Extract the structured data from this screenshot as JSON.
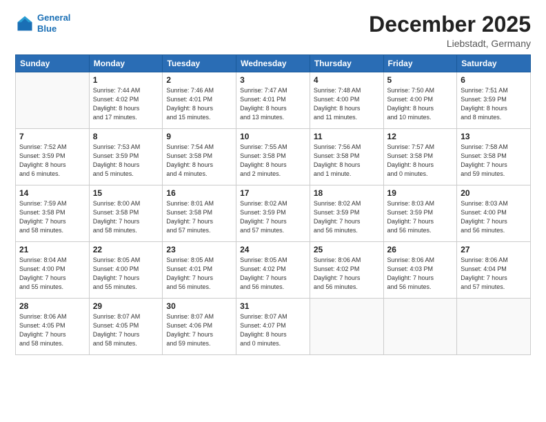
{
  "header": {
    "logo_line1": "General",
    "logo_line2": "Blue",
    "month": "December 2025",
    "location": "Liebstadt, Germany"
  },
  "weekdays": [
    "Sunday",
    "Monday",
    "Tuesday",
    "Wednesday",
    "Thursday",
    "Friday",
    "Saturday"
  ],
  "weeks": [
    [
      {
        "day": "",
        "info": ""
      },
      {
        "day": "1",
        "info": "Sunrise: 7:44 AM\nSunset: 4:02 PM\nDaylight: 8 hours\nand 17 minutes."
      },
      {
        "day": "2",
        "info": "Sunrise: 7:46 AM\nSunset: 4:01 PM\nDaylight: 8 hours\nand 15 minutes."
      },
      {
        "day": "3",
        "info": "Sunrise: 7:47 AM\nSunset: 4:01 PM\nDaylight: 8 hours\nand 13 minutes."
      },
      {
        "day": "4",
        "info": "Sunrise: 7:48 AM\nSunset: 4:00 PM\nDaylight: 8 hours\nand 11 minutes."
      },
      {
        "day": "5",
        "info": "Sunrise: 7:50 AM\nSunset: 4:00 PM\nDaylight: 8 hours\nand 10 minutes."
      },
      {
        "day": "6",
        "info": "Sunrise: 7:51 AM\nSunset: 3:59 PM\nDaylight: 8 hours\nand 8 minutes."
      }
    ],
    [
      {
        "day": "7",
        "info": "Sunrise: 7:52 AM\nSunset: 3:59 PM\nDaylight: 8 hours\nand 6 minutes."
      },
      {
        "day": "8",
        "info": "Sunrise: 7:53 AM\nSunset: 3:59 PM\nDaylight: 8 hours\nand 5 minutes."
      },
      {
        "day": "9",
        "info": "Sunrise: 7:54 AM\nSunset: 3:58 PM\nDaylight: 8 hours\nand 4 minutes."
      },
      {
        "day": "10",
        "info": "Sunrise: 7:55 AM\nSunset: 3:58 PM\nDaylight: 8 hours\nand 2 minutes."
      },
      {
        "day": "11",
        "info": "Sunrise: 7:56 AM\nSunset: 3:58 PM\nDaylight: 8 hours\nand 1 minute."
      },
      {
        "day": "12",
        "info": "Sunrise: 7:57 AM\nSunset: 3:58 PM\nDaylight: 8 hours\nand 0 minutes."
      },
      {
        "day": "13",
        "info": "Sunrise: 7:58 AM\nSunset: 3:58 PM\nDaylight: 7 hours\nand 59 minutes."
      }
    ],
    [
      {
        "day": "14",
        "info": "Sunrise: 7:59 AM\nSunset: 3:58 PM\nDaylight: 7 hours\nand 58 minutes."
      },
      {
        "day": "15",
        "info": "Sunrise: 8:00 AM\nSunset: 3:58 PM\nDaylight: 7 hours\nand 58 minutes."
      },
      {
        "day": "16",
        "info": "Sunrise: 8:01 AM\nSunset: 3:58 PM\nDaylight: 7 hours\nand 57 minutes."
      },
      {
        "day": "17",
        "info": "Sunrise: 8:02 AM\nSunset: 3:59 PM\nDaylight: 7 hours\nand 57 minutes."
      },
      {
        "day": "18",
        "info": "Sunrise: 8:02 AM\nSunset: 3:59 PM\nDaylight: 7 hours\nand 56 minutes."
      },
      {
        "day": "19",
        "info": "Sunrise: 8:03 AM\nSunset: 3:59 PM\nDaylight: 7 hours\nand 56 minutes."
      },
      {
        "day": "20",
        "info": "Sunrise: 8:03 AM\nSunset: 4:00 PM\nDaylight: 7 hours\nand 56 minutes."
      }
    ],
    [
      {
        "day": "21",
        "info": "Sunrise: 8:04 AM\nSunset: 4:00 PM\nDaylight: 7 hours\nand 55 minutes."
      },
      {
        "day": "22",
        "info": "Sunrise: 8:05 AM\nSunset: 4:00 PM\nDaylight: 7 hours\nand 55 minutes."
      },
      {
        "day": "23",
        "info": "Sunrise: 8:05 AM\nSunset: 4:01 PM\nDaylight: 7 hours\nand 56 minutes."
      },
      {
        "day": "24",
        "info": "Sunrise: 8:05 AM\nSunset: 4:02 PM\nDaylight: 7 hours\nand 56 minutes."
      },
      {
        "day": "25",
        "info": "Sunrise: 8:06 AM\nSunset: 4:02 PM\nDaylight: 7 hours\nand 56 minutes."
      },
      {
        "day": "26",
        "info": "Sunrise: 8:06 AM\nSunset: 4:03 PM\nDaylight: 7 hours\nand 56 minutes."
      },
      {
        "day": "27",
        "info": "Sunrise: 8:06 AM\nSunset: 4:04 PM\nDaylight: 7 hours\nand 57 minutes."
      }
    ],
    [
      {
        "day": "28",
        "info": "Sunrise: 8:06 AM\nSunset: 4:05 PM\nDaylight: 7 hours\nand 58 minutes."
      },
      {
        "day": "29",
        "info": "Sunrise: 8:07 AM\nSunset: 4:05 PM\nDaylight: 7 hours\nand 58 minutes."
      },
      {
        "day": "30",
        "info": "Sunrise: 8:07 AM\nSunset: 4:06 PM\nDaylight: 7 hours\nand 59 minutes."
      },
      {
        "day": "31",
        "info": "Sunrise: 8:07 AM\nSunset: 4:07 PM\nDaylight: 8 hours\nand 0 minutes."
      },
      {
        "day": "",
        "info": ""
      },
      {
        "day": "",
        "info": ""
      },
      {
        "day": "",
        "info": ""
      }
    ]
  ]
}
